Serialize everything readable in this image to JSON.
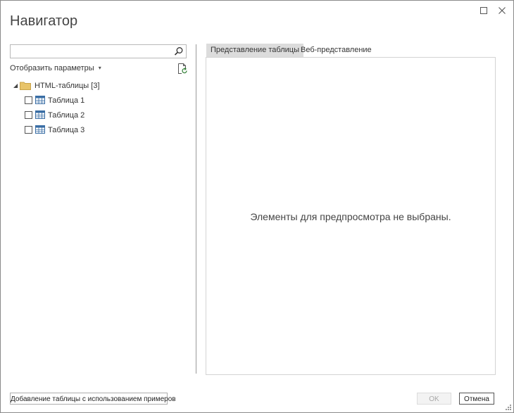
{
  "window": {
    "title": "Навигатор",
    "maximize_icon": "maximize-icon",
    "close_icon": "close-icon"
  },
  "search": {
    "value": "",
    "placeholder": "",
    "icon": "search-icon"
  },
  "display_options": {
    "label": "Отобразить параметры",
    "caret": "▾"
  },
  "refresh_icon": "refresh-icon",
  "tree": {
    "root": {
      "expander": "◢",
      "label": "HTML-таблицы [3]",
      "icon": "folder-icon"
    },
    "items": [
      {
        "label": "Таблица 1",
        "checked": false,
        "icon": "table-icon"
      },
      {
        "label": "Таблица 2",
        "checked": false,
        "icon": "table-icon"
      },
      {
        "label": "Таблица 3",
        "checked": false,
        "icon": "table-icon"
      }
    ]
  },
  "tabs": [
    {
      "label": "Представление таблицы",
      "active": true
    },
    {
      "label": "Веб-представление",
      "active": false
    }
  ],
  "preview": {
    "empty_message": "Элементы для предпросмотра не выбраны."
  },
  "footer": {
    "add_table_label": "Добавление таблицы с использованием примеров",
    "ok_label": "OK",
    "ok_disabled": true,
    "cancel_label": "Отмена"
  },
  "colors": {
    "active_tab_bg": "#dcdcdc",
    "folder": "#e8c46a",
    "table_icon": "#3a6ea5"
  }
}
